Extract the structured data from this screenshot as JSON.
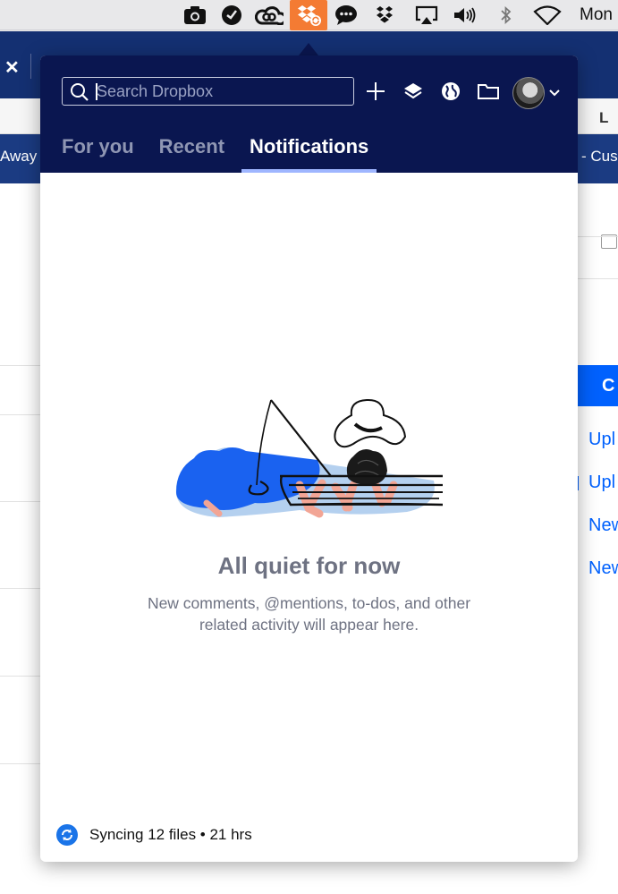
{
  "menubar": {
    "icons": [
      "camera-icon",
      "checkmark-circle-icon",
      "creative-cloud-icon",
      "dropbox-syncing-icon",
      "messages-icon",
      "dropbox-outline-icon",
      "airplay-icon",
      "volume-icon",
      "bluetooth-icon",
      "wifi-icon"
    ],
    "clock": "Mon"
  },
  "background_app": {
    "close_glyph": "✕",
    "tab_letter": "L",
    "banner_left": "Away |",
    "banner_right": "- Cus",
    "button_label": "C",
    "links": [
      "Upl",
      "Upl",
      "New",
      "New"
    ]
  },
  "popover": {
    "search": {
      "placeholder": "Search Dropbox",
      "value": ""
    },
    "header_buttons": [
      "add-icon",
      "dropbox-layers-icon",
      "globe-icon",
      "folder-icon"
    ],
    "tabs": [
      {
        "label": "For you",
        "active": false
      },
      {
        "label": "Recent",
        "active": false
      },
      {
        "label": "Notifications",
        "active": true
      }
    ],
    "empty_state": {
      "title": "All quiet for now",
      "description": "New comments, @mentions, to-dos, and other related activity will appear here."
    },
    "footer": {
      "status": "Syncing 12 files • 21 hrs"
    }
  },
  "colors": {
    "header_bg": "#0a1650",
    "accent": "#0061fe",
    "dropbox_orange": "#f47b33",
    "tab_underline": "#9fb6ff"
  }
}
